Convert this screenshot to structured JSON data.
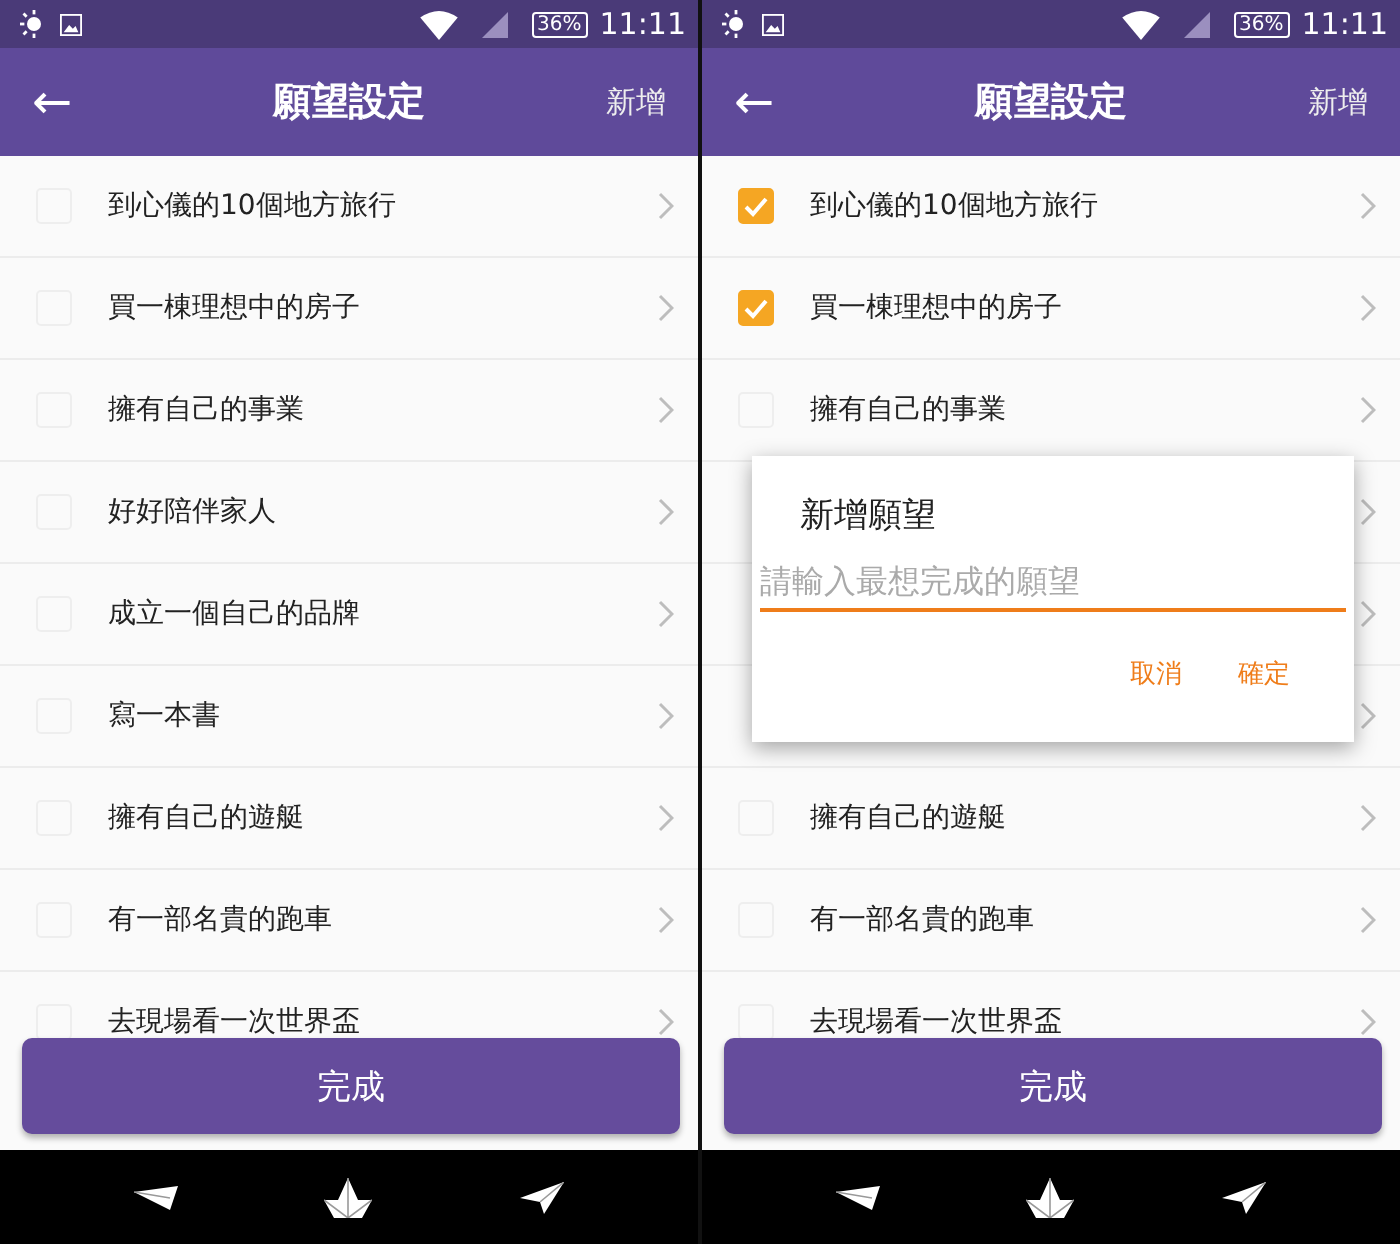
{
  "screens": [
    {
      "status_bar": {
        "battery": "36%",
        "time": "11:11"
      },
      "app_bar": {
        "back": "←",
        "title": "願望設定",
        "action": "新增"
      },
      "items": [
        {
          "kind": "wish",
          "label": "到心儀的10個地方旅行",
          "checked": false
        },
        {
          "kind": "wish",
          "label": "買一棟理想中的房子",
          "checked": false
        },
        {
          "kind": "wish",
          "label": "擁有自己的事業",
          "checked": false
        },
        {
          "kind": "wish",
          "label": "好好陪伴家人",
          "checked": false
        },
        {
          "kind": "wish",
          "label": "成立一個自己的品牌",
          "checked": false
        },
        {
          "kind": "wish",
          "label": "寫一本書",
          "checked": false
        },
        {
          "kind": "wish",
          "label": "擁有自己的遊艇",
          "checked": false
        },
        {
          "kind": "wish",
          "label": "有一部名貴的跑車",
          "checked": false
        },
        {
          "kind": "wish",
          "label": "去現場看一次世界盃",
          "checked": false
        }
      ],
      "done_button": "完成"
    },
    {
      "status_bar": {
        "battery": "36%",
        "time": "11:11"
      },
      "app_bar": {
        "back": "←",
        "title": "願望設定",
        "action": "新增"
      },
      "items": [
        {
          "kind": "wish",
          "label": "到心儀的10個地方旅行",
          "checked": true
        },
        {
          "kind": "wish",
          "label": "買一棟理想中的房子",
          "checked": true
        },
        {
          "kind": "wish",
          "label": "擁有自己的事業",
          "checked": false
        },
        {
          "kind": "covered"
        },
        {
          "kind": "covered"
        },
        {
          "kind": "covered"
        },
        {
          "kind": "wish",
          "label": "擁有自己的遊艇",
          "checked": false
        },
        {
          "kind": "wish",
          "label": "有一部名貴的跑車",
          "checked": false
        },
        {
          "kind": "wish",
          "label": "去現場看一次世界盃",
          "checked": false
        }
      ],
      "dialog": {
        "title": "新增願望",
        "placeholder": "請輸入最想完成的願望",
        "buttons": [
          "取消",
          "確定"
        ]
      },
      "done_button": "完成"
    }
  ]
}
